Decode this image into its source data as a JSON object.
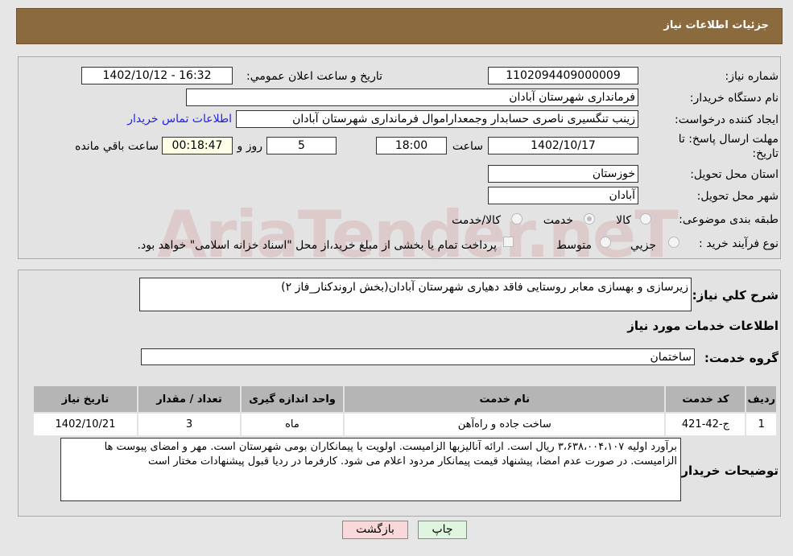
{
  "header": {
    "title": "جزئیات اطلاعات نیاز"
  },
  "form": {
    "need_number_label": "شماره نیاز:",
    "need_number": "1102094409000009",
    "announce_label": "تاریخ و ساعت اعلان عمومي:",
    "announce_value": "1402/10/12 - 16:32",
    "buyer_org_label": "نام دستگاه خریدار:",
    "buyer_org": "فرمانداری شهرستان آبادان",
    "creator_label": "ایجاد کننده درخواست:",
    "creator": "زینب تنگسیری ناصری حسابدار وجمعداراموال فرمانداری شهرستان آبادان",
    "contact_link": "اطلاعات تماس خریدار",
    "deadline_label": "مهلت ارسال پاسخ: تا تاریخ:",
    "deadline_date": "1402/10/17",
    "time_label": "ساعت",
    "deadline_time": "18:00",
    "days": "5",
    "days_label": "روز و",
    "remaining": "00:18:47",
    "remaining_label": "ساعت باقي مانده",
    "province_label": "استان محل تحویل:",
    "province": "خوزستان",
    "city_label": "شهر محل تحویل:",
    "city": "آبادان",
    "category_label": "طبقه بندی موضوعی:",
    "category_options": [
      "کالا",
      "خدمت",
      "کالا/خدمت"
    ],
    "category_selected": "خدمت",
    "process_label": "نوع فرآیند خرید :",
    "process_options": [
      "جزيي",
      "متوسط"
    ],
    "payment_note": "پرداخت تمام یا بخشی از مبلغ خرید،از محل \"اسناد خزانه اسلامی\" خواهد بود."
  },
  "details": {
    "desc_label": "شرح کلي نیاز:",
    "desc": "زیرسازی و بهسازی معابر روستایی فاقد دهیاری شهرستان آبادان(بخش اروندکنار_فاز ۲)",
    "services_title": "اطلاعات خدمات مورد نیاز",
    "group_label": "گروه خدمت:",
    "group": "ساختمان",
    "table": {
      "headers": [
        "ردیف",
        "کد خدمت",
        "نام خدمت",
        "واحد اندازه گیری",
        "تعداد / مقدار",
        "تاریخ نیاز"
      ],
      "rows": [
        [
          "1",
          "ج-42-421",
          "ساخت جاده و راه‌آهن",
          "ماه",
          "3",
          "1402/10/21"
        ]
      ]
    },
    "notes_label": "توضیحات خریدار:",
    "notes": "برآورد اولیه ۳،۶۳۸،۰۰۴،۱۰۷ ریال است. ارائه آنالیزبها الزامیست. اولویت با پیمانکاران بومی شهرستان است. مهر و امضای پیوست ها الزامیست. در صورت عدم امضا، پیشنهاد قیمت پیمانکار مردود اعلام می شود. کارفرما در ردیا قبول پیشنهادات مختار است"
  },
  "buttons": {
    "print": "چاپ",
    "back": "بازگشت"
  },
  "watermark": "AriaTender.neT"
}
